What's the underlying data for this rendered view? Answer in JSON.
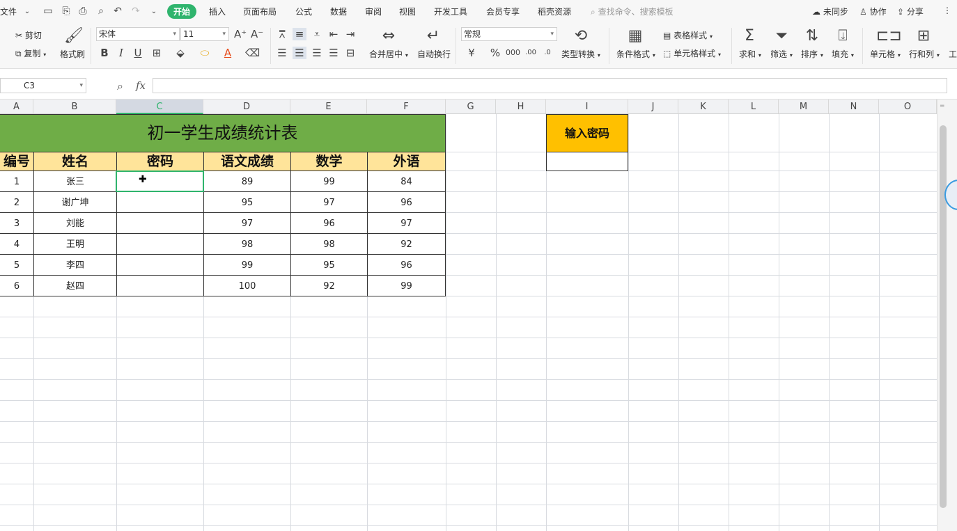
{
  "menubar": {
    "file": "文件",
    "tabs": [
      "开始",
      "插入",
      "页面布局",
      "公式",
      "数据",
      "审阅",
      "视图",
      "开发工具",
      "会员专享",
      "稻壳资源"
    ],
    "search": "查找命令、搜索模板",
    "sync": "未同步",
    "collab": "协作",
    "share": "分享"
  },
  "ribbon": {
    "cut": "剪切",
    "copy": "复制",
    "format_painter": "格式刷",
    "font_name": "宋体",
    "font_size": "11",
    "merge_center": "合并居中",
    "wrap_text": "自动换行",
    "number_format": "常规",
    "type_convert": "类型转换",
    "cond_format": "条件格式",
    "table_style": "表格样式",
    "cell_style": "单元格样式",
    "sum": "求和",
    "filter": "筛选",
    "sort": "排序",
    "fill": "填充",
    "cell": "单元格",
    "row_col": "行和列",
    "worksheet": "工"
  },
  "formula_bar": {
    "name_box": "C3",
    "fx": "fx",
    "value": ""
  },
  "columns": [
    "A",
    "B",
    "C",
    "D",
    "E",
    "F",
    "G",
    "H",
    "I",
    "J",
    "K",
    "L",
    "M",
    "N",
    "O"
  ],
  "sheet": {
    "title": "初一学生成绩统计表",
    "headers": [
      "编号",
      "姓名",
      "密码",
      "语文成绩",
      "数学",
      "外语"
    ],
    "rows": [
      [
        "1",
        "张三",
        "",
        "89",
        "99",
        "84"
      ],
      [
        "2",
        "谢广坤",
        "",
        "95",
        "97",
        "96"
      ],
      [
        "3",
        "刘能",
        "",
        "97",
        "96",
        "97"
      ],
      [
        "4",
        "王明",
        "",
        "98",
        "98",
        "92"
      ],
      [
        "5",
        "李四",
        "",
        "99",
        "95",
        "96"
      ],
      [
        "6",
        "赵四",
        "",
        "100",
        "92",
        "99"
      ]
    ],
    "password_label": "输入密码",
    "password_value": ""
  },
  "colors": {
    "accent": "#2fb46d",
    "title_bg": "#6fad47",
    "header_bg": "#ffe49a",
    "password_bg": "#ffc000"
  }
}
